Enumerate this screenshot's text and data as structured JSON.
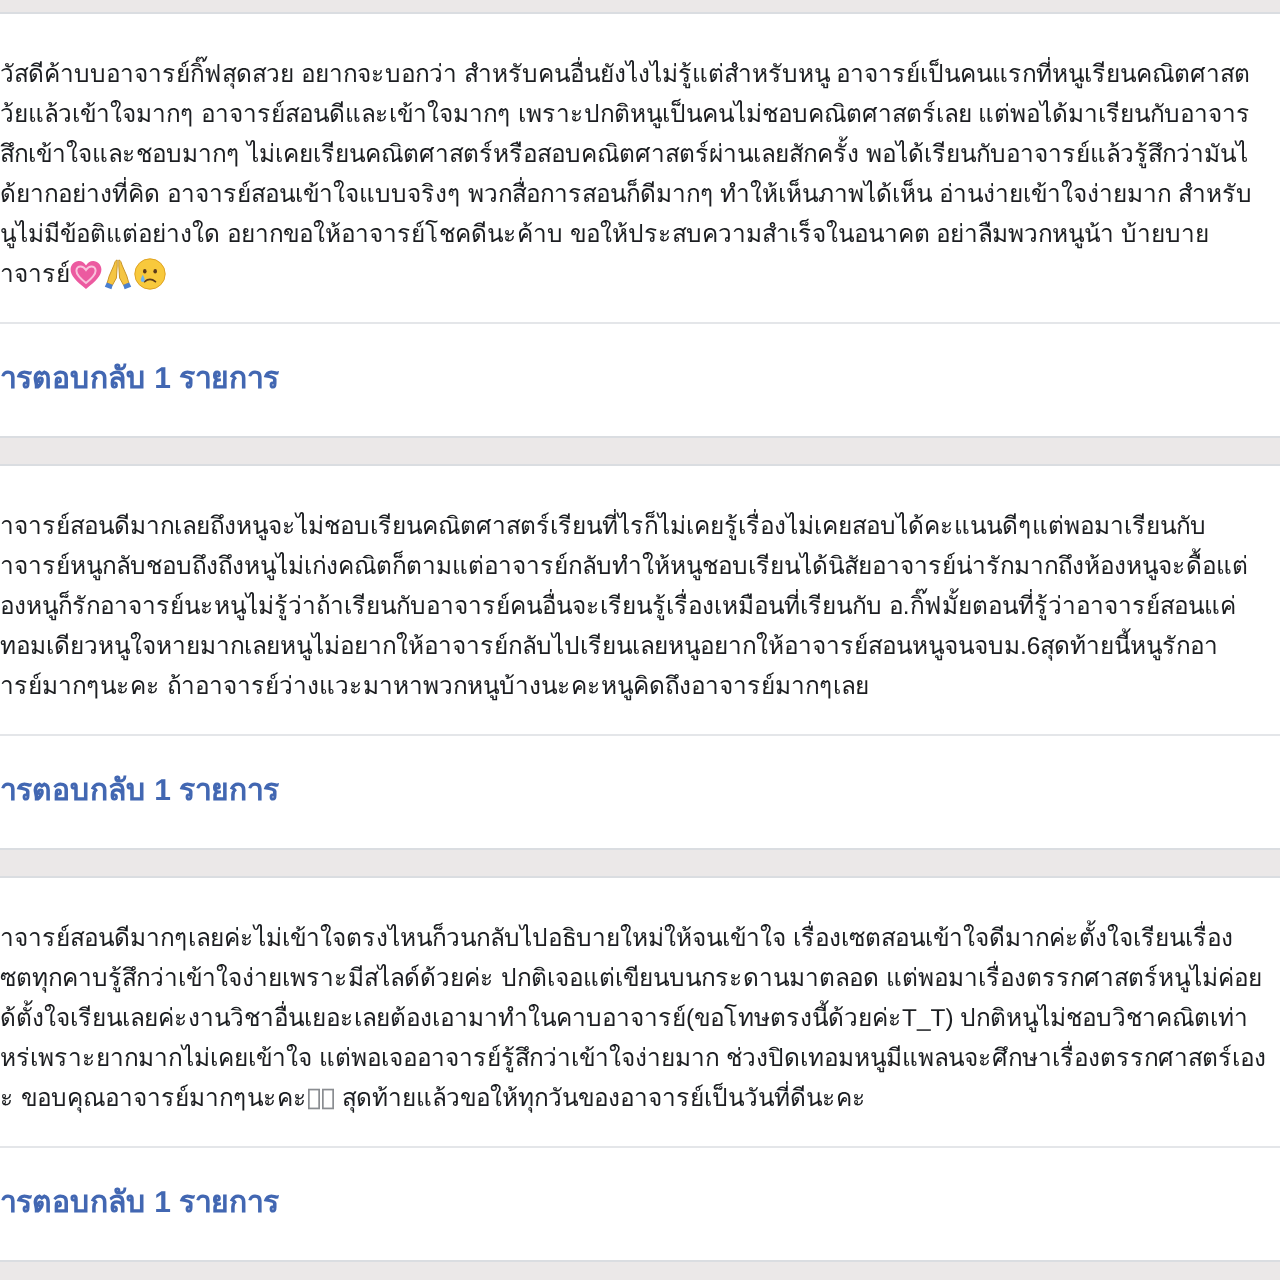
{
  "comments": [
    {
      "lines": [
        [
          {
            "kind": "text",
            "text": "วัสดีค้าบบอาจารย์กิ๊ฟสุดสวย อยากจะบอกว่า สำหรับคนอื่นยังไงไม่รู้แต่สำหรับหนู อาจารย์เป็นคนแรกที่หนูเรียนคณิตศาสต"
          }
        ],
        [
          {
            "kind": "text",
            "text": "ว้ยแล้วเข้าใจมากๆ อาจารย์สอนดีและเข้าใจมากๆ เพราะปกติหนูเป็นคนไม่ชอบคณิตศาสตร์เลย แต่พอได้มาเรียนกับอาจาร"
          }
        ],
        [
          {
            "kind": "text",
            "text": "สึกเข้าใจและชอบมากๆ ไม่เคยเรียนคณิตศาสตร์หรือสอบคณิตศาสตร์ผ่านเลยสักครั้ง พอได้เรียนกับอาจารย์แล้วรู้สึกว่ามันไ"
          }
        ],
        [
          {
            "kind": "text",
            "text": "ด้ยากอย่างที่คิด อาจารย์สอนเข้าใจแบบจริงๆ พวกสื่อการสอนก็ดีมากๆ ทำให้เห็นภาพได้เห็น อ่านง่ายเข้าใจง่ายมาก สำหรับ"
          }
        ],
        [
          {
            "kind": "text",
            "text": "นูไม่มีข้อติแต่อย่างใด อยากขอให้อาจารย์โชคดีนะค้าบ ขอให้ประสบความสำเร็จในอนาคต อย่าลืมพวกหนูน้า บ้ายบาย"
          }
        ],
        [
          {
            "kind": "text",
            "text": "าจารย์"
          },
          {
            "kind": "heart"
          },
          {
            "kind": "folded_hands"
          },
          {
            "kind": "crying_face"
          }
        ]
      ],
      "replies_link": "ารตอบกลับ 1 รายการ"
    },
    {
      "lines": [
        [
          {
            "kind": "text",
            "text": "าจารย์สอนดีมากเลยถึงหนูจะไม่ชอบเรียนคณิตศาสตร์เรียนที่ไรก็ไม่เคยรู้เรื่องไม่เคยสอบได้คะแนนดีๆแต่พอมาเรียนกับ"
          }
        ],
        [
          {
            "kind": "text",
            "text": "าจารย์หนูกลับชอบถึงถึงหนูไม่เก่งคณิตก็ตามแต่อาจารย์กลับทำให้หนูชอบเรียนได้นิสัยอาจารย์น่ารักมากถึงห้องหนูจะดื้อแต่"
          }
        ],
        [
          {
            "kind": "text",
            "text": "องหนูก็รักอาจารย์นะหนูไม่รู้ว่าถ้าเรียนกับอาจารย์คนอื่นจะเรียนรู้เรื่องเหมือนที่เรียนกับ อ.กิ๊ฟมั้ยตอนที่รู้ว่าอาจารย์สอนแค่"
          }
        ],
        [
          {
            "kind": "text",
            "text": "ทอมเดียวหนูใจหายมากเลยหนูไม่อยากให้อาจารย์กลับไปเรียนเลยหนูอยากให้อาจารย์สอนหนูจนจบม.6สุดท้ายนี้หนูรักอา"
          }
        ],
        [
          {
            "kind": "text",
            "text": "ารย์มากๆนะคะ ถ้าอาจารย์ว่างแวะมาหาพวกหนูบ้างนะคะหนูคิดถึงอาจารย์มากๆเลย"
          }
        ]
      ],
      "replies_link": "ารตอบกลับ 1 รายการ"
    },
    {
      "lines": [
        [
          {
            "kind": "text",
            "text": "าจารย์สอนดีมากๆเลยค่ะไม่เข้าใจตรงไหนก็วนกลับไปอธิบายใหม่ให้จนเข้าใจ เรื่องเซตสอนเข้าใจดีมากค่ะตั้งใจเรียนเรื่อง"
          }
        ],
        [
          {
            "kind": "text",
            "text": "ซตทุกคาบรู้สึกว่าเข้าใจง่ายเพราะมีสไลด์ด้วยค่ะ ปกติเจอแต่เขียนบนกระดานมาตลอด แต่พอมาเรื่องตรรกศาสตร์หนูไม่ค่อย"
          }
        ],
        [
          {
            "kind": "text",
            "text": "ด้ตั้งใจเรียนเลยค่ะงานวิชาอื่นเยอะเลยต้องเอามาทำในคาบอาจารย์(ขอโทษตรงนี้ด้วยค่ะT_T) ปกติหนูไม่ชอบวิชาคณิตเท่า"
          }
        ],
        [
          {
            "kind": "text",
            "text": "หร่เพราะยากมากไม่เคยเข้าใจ แต่พอเจออาจารย์รู้สึกว่าเข้าใจง่ายมาก ช่วงปิดเทอมหนูมีแพลนจะศึกษาเรื่องตรรกศาสตร์เอง"
          }
        ],
        [
          {
            "kind": "text",
            "text": "ะ ขอบคุณอาจารย์มากๆนะคะ"
          },
          {
            "kind": "missing_glyph"
          },
          {
            "kind": "missing_glyph"
          },
          {
            "kind": "text",
            "text": " สุดท้ายแล้วขอให้ทุกวันของอาจารย์เป็นวันที่ดีนะคะ"
          }
        ]
      ],
      "replies_link": "ารตอบกลับ 1 รายการ"
    }
  ]
}
